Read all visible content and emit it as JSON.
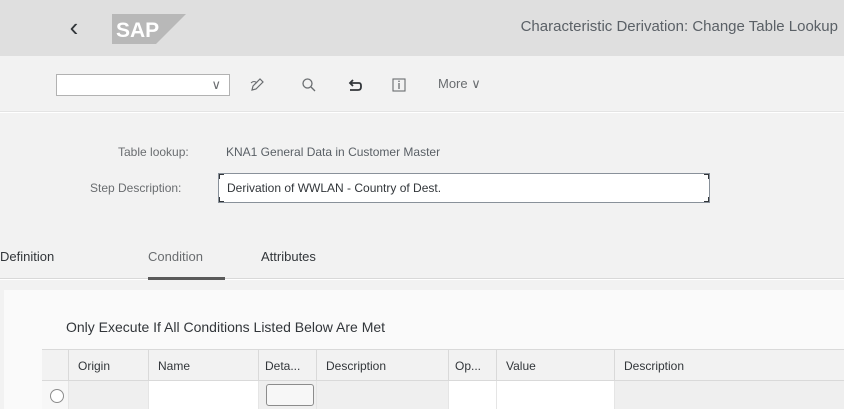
{
  "shell": {
    "back_icon": "chevron-left-icon",
    "logo_text": "SAP",
    "title": "Characteristic Derivation: Change Table Lookup"
  },
  "toolbar": {
    "select_value": "",
    "icons": [
      "edit-pencil-icon",
      "find-icon",
      "undo-icon",
      "info-icon"
    ],
    "more_label": "More"
  },
  "header": {
    "table_lookup_label": "Table lookup:",
    "table_lookup_value": "KNA1 General Data in Customer Master",
    "step_description_label": "Step Description:",
    "step_description_value": "Derivation of WWLAN - Country of Dest."
  },
  "tabs": [
    {
      "label": "Definition",
      "active": false
    },
    {
      "label": "Condition",
      "active": true
    },
    {
      "label": "Attributes",
      "active": false
    }
  ],
  "conditions": {
    "title": "Only Execute If All Conditions Listed Below Are Met",
    "columns": [
      "Origin",
      "Name",
      "Deta...",
      "Description",
      "Op...",
      "Value",
      "Description"
    ],
    "rows": [
      {
        "origin": "",
        "name": "",
        "detail": "",
        "description": "",
        "operator": "",
        "value": "",
        "value_description": ""
      }
    ]
  },
  "colors": {
    "shell_bg": "#dfdfdf",
    "toolbar_bg": "#f2f2f2",
    "text": "#32363a",
    "muted_text": "#6a6d70"
  }
}
